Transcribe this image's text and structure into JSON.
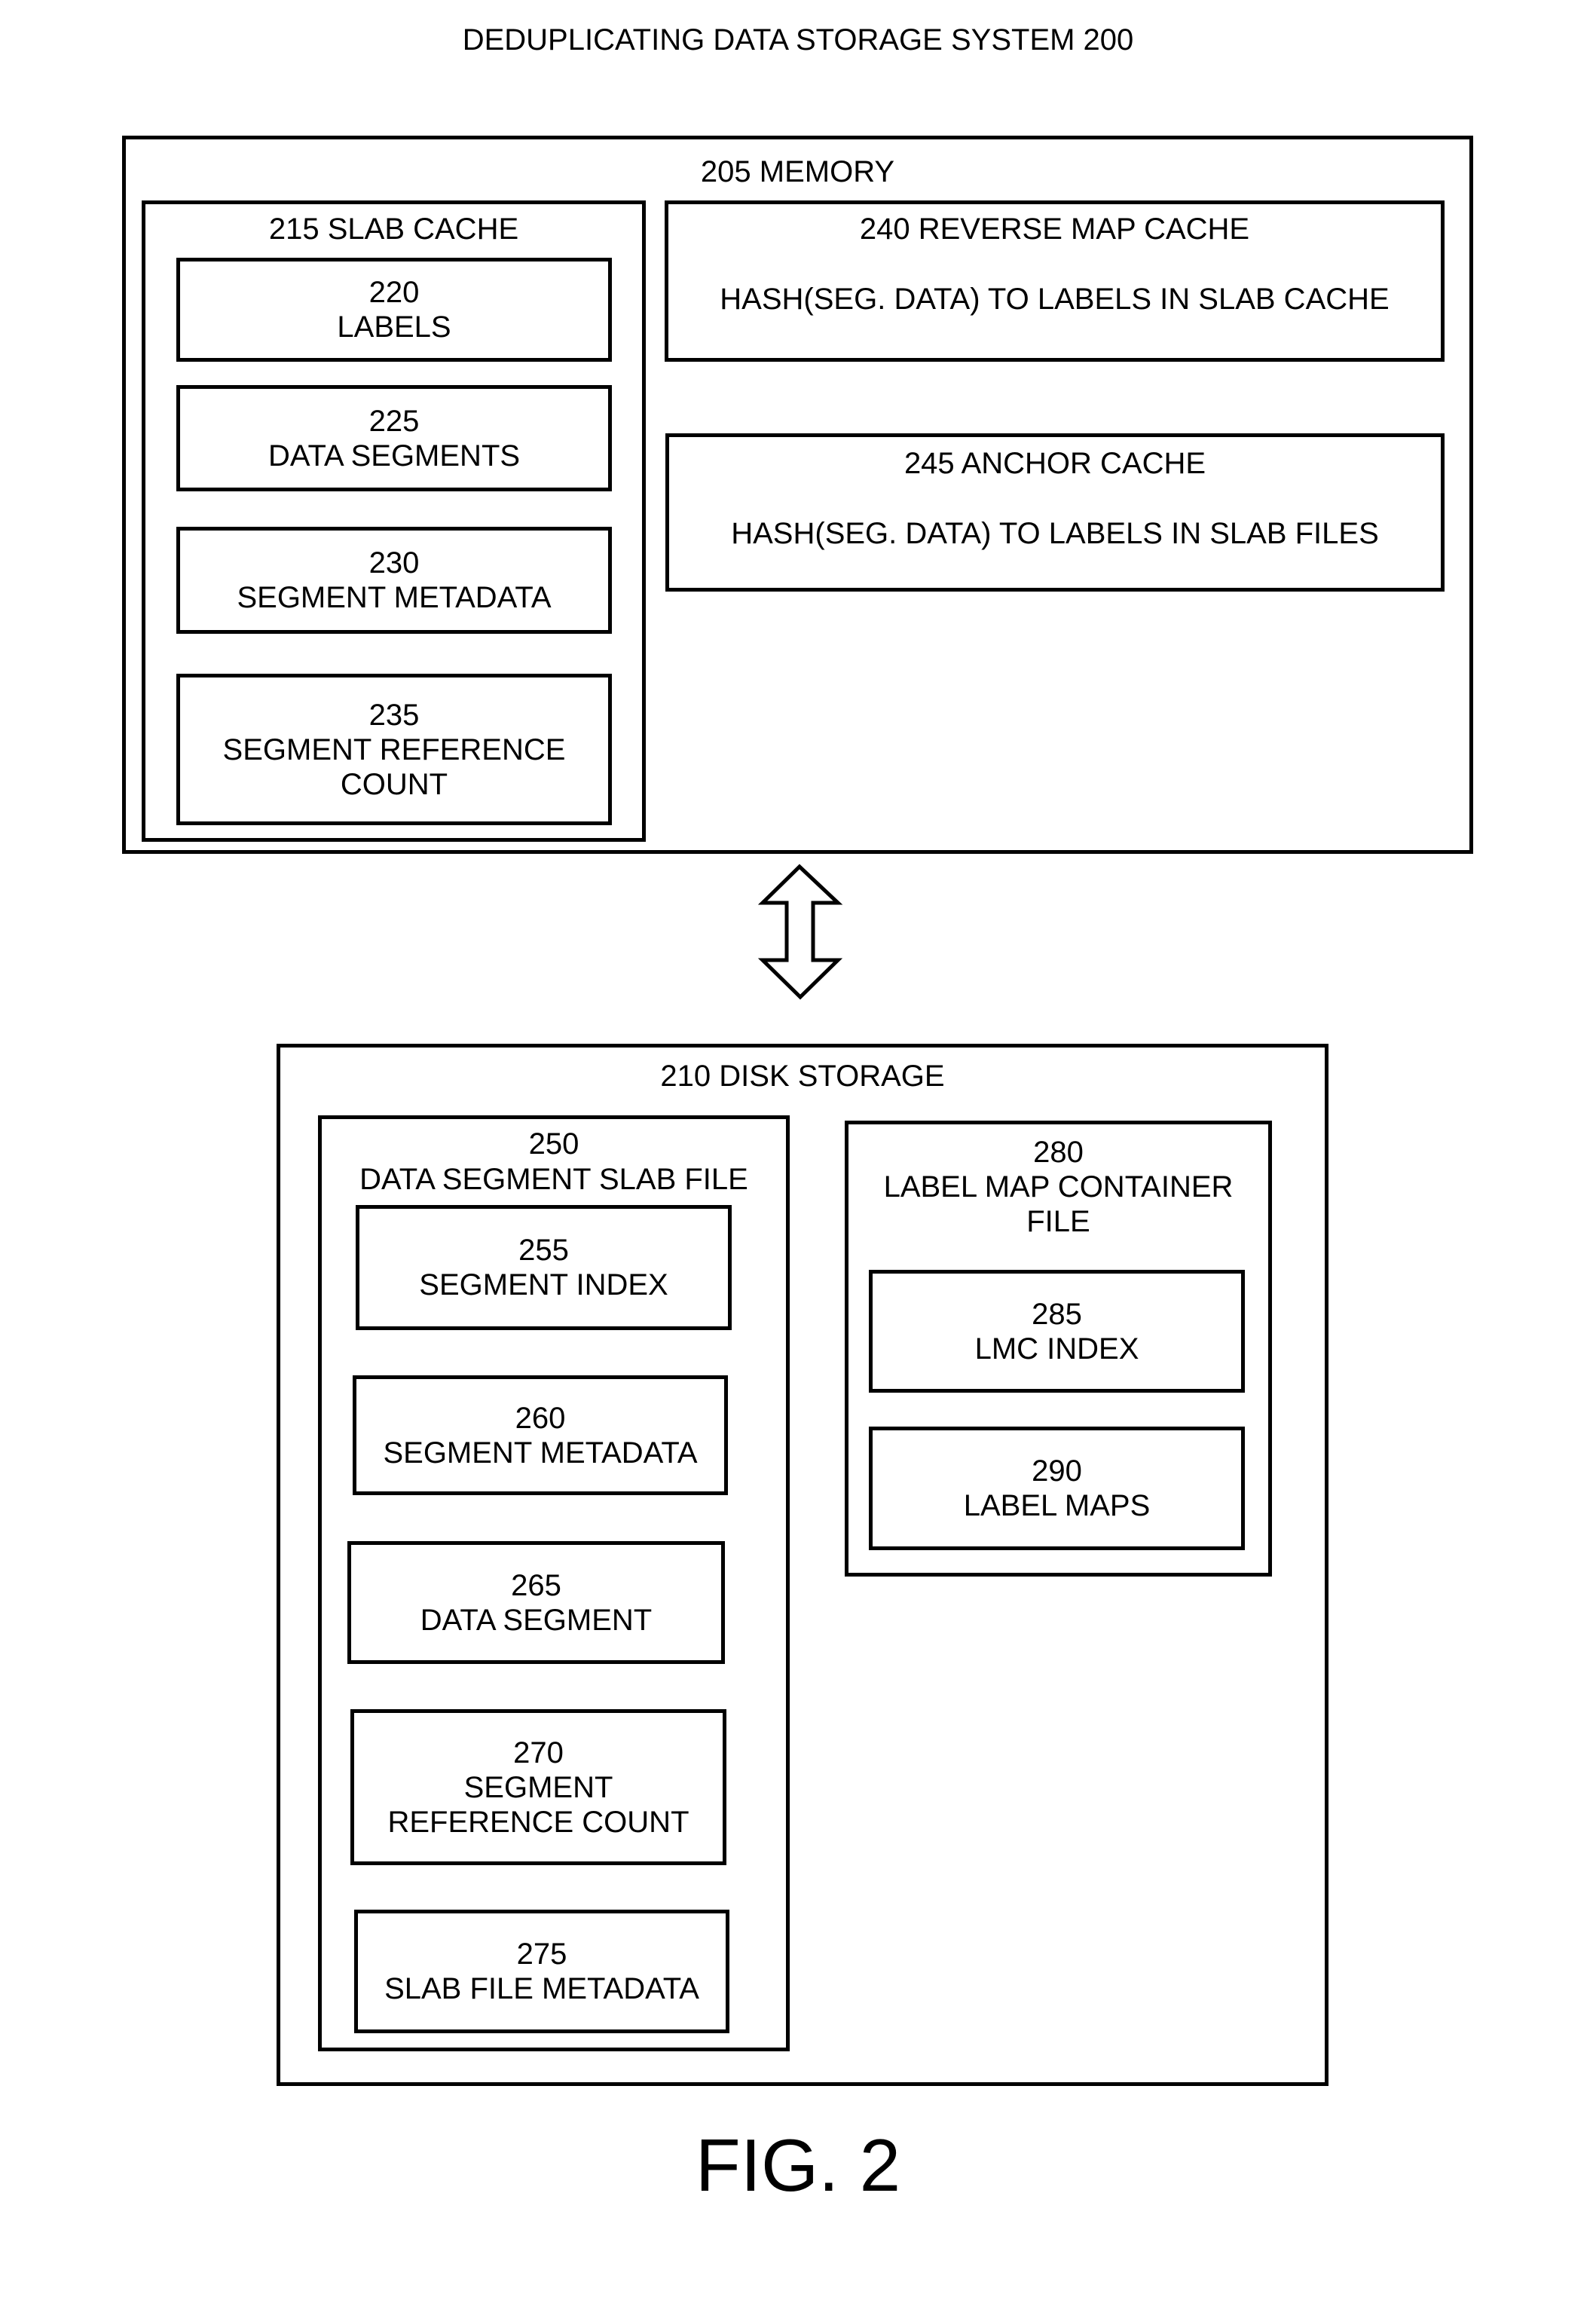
{
  "title": "DEDUPLICATING DATA STORAGE SYSTEM 200",
  "figure_label": "FIG. 2",
  "memory": {
    "title": "205 MEMORY",
    "slab_cache": {
      "title": "215 SLAB CACHE",
      "items": [
        {
          "lines": [
            "220",
            "LABELS"
          ]
        },
        {
          "lines": [
            "225",
            "DATA SEGMENTS"
          ]
        },
        {
          "lines": [
            "230",
            "SEGMENT METADATA"
          ]
        },
        {
          "lines": [
            "235",
            "SEGMENT REFERENCE",
            "COUNT"
          ]
        }
      ]
    },
    "reverse_map_cache": {
      "title": "240 REVERSE MAP CACHE",
      "description": "HASH(SEG. DATA) TO LABELS IN SLAB CACHE"
    },
    "anchor_cache": {
      "title": "245 ANCHOR CACHE",
      "description": "HASH(SEG. DATA) TO LABELS IN SLAB FILES"
    }
  },
  "connector": {
    "icon": "bidirectional-arrow-icon"
  },
  "disk": {
    "title": "210 DISK STORAGE",
    "slab_file": {
      "title_lines": [
        "250",
        "DATA SEGMENT SLAB FILE"
      ],
      "items": [
        {
          "lines": [
            "255",
            "SEGMENT INDEX"
          ]
        },
        {
          "lines": [
            "260",
            "SEGMENT METADATA"
          ]
        },
        {
          "lines": [
            "265",
            "DATA SEGMENT"
          ]
        },
        {
          "lines": [
            "270",
            "SEGMENT",
            "REFERENCE COUNT"
          ]
        },
        {
          "lines": [
            "275",
            "SLAB FILE METADATA"
          ]
        }
      ]
    },
    "label_map_container": {
      "title_lines": [
        "280",
        "LABEL MAP CONTAINER",
        "FILE"
      ],
      "items": [
        {
          "lines": [
            "285",
            "LMC INDEX"
          ]
        },
        {
          "lines": [
            "290",
            "LABEL MAPS"
          ]
        }
      ]
    }
  }
}
